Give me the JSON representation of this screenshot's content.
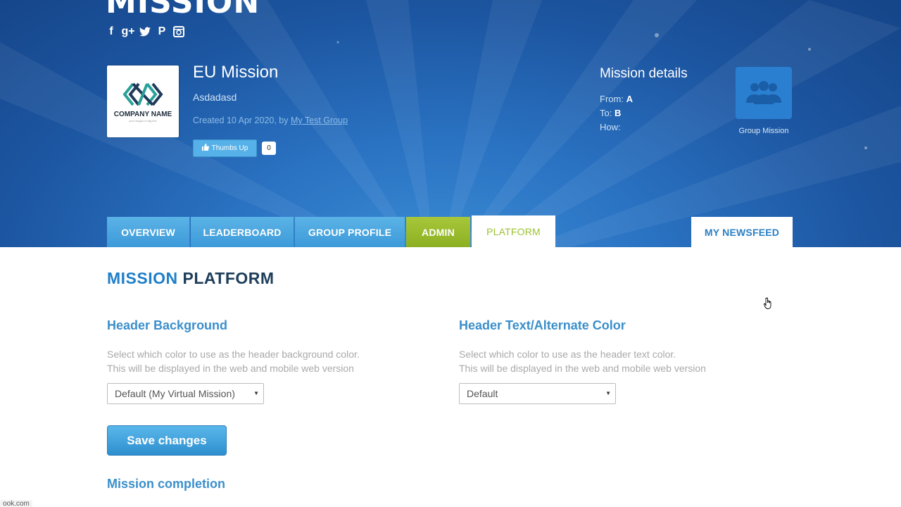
{
  "header": {
    "brand": "MISSION",
    "social_icons": [
      "facebook-icon",
      "google-plus-icon",
      "twitter-icon",
      "pinterest-icon",
      "instagram-icon"
    ],
    "social_glyphs": [
      "f",
      "g+",
      "t",
      "P",
      "◙"
    ],
    "logo": {
      "name": "COMPANY NAME",
      "slogan": "your slogan or tag line"
    },
    "mission_title": "EU Mission",
    "mission_subtitle": "Asdadasd",
    "created_prefix": "Created 10 Apr 2020, by ",
    "created_by": "My Test Group",
    "thumbs_label": "Thumbs Up",
    "thumbs_count": "0",
    "details_title": "Mission details",
    "from_label": "From:",
    "from_value": "A",
    "to_label": "To:",
    "to_value": "B",
    "how_label": "How:",
    "group_label": "Group Mission"
  },
  "tabs": {
    "overview": "OVERVIEW",
    "leaderboard": "LEADERBOARD",
    "group_profile": "GROUP PROFILE",
    "admin": "ADMIN",
    "platform": "PLATFORM",
    "newsfeed": "MY NEWSFEED"
  },
  "content": {
    "heading_accent": "MISSION",
    "heading_rest": "PLATFORM",
    "bg_section": {
      "title": "Header Background",
      "desc1": "Select which color to use as the header background color.",
      "desc2": "This will be displayed in the web and mobile web version",
      "selected": "Default (My Virtual Mission)"
    },
    "text_section": {
      "title": "Header Text/Alternate Color",
      "desc1": "Select which color to use as the header text color.",
      "desc2": "This will be displayed in the web and mobile web version",
      "selected": "Default"
    },
    "save_label": "Save changes",
    "completion_title": "Mission completion"
  },
  "statusbar": "ook.com",
  "colors": {
    "header_bg": "#2a72c2",
    "tab_blue": "#4aa6de",
    "tab_green": "#9bc231",
    "heading_dark": "#1c3d5a",
    "accent_blue": "#1f7fc9"
  }
}
